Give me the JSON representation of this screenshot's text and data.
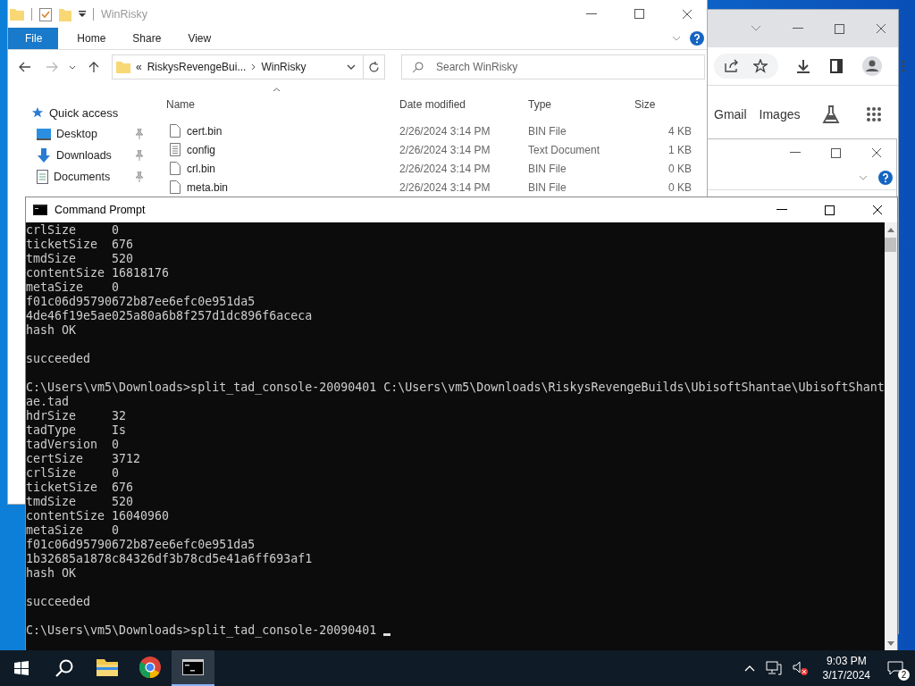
{
  "browser": {
    "links": [
      "Gmail",
      "Images"
    ]
  },
  "explorer": {
    "title": "WinRisky",
    "ribbon_tabs": [
      {
        "label": "File",
        "kind": "file"
      },
      {
        "label": "Home",
        "kind": "tab"
      },
      {
        "label": "Share",
        "kind": "tab"
      },
      {
        "label": "View",
        "kind": "tab"
      }
    ],
    "address": {
      "overflow": "«",
      "path": [
        "RiskysRevengeBui...",
        "WinRisky"
      ]
    },
    "search": {
      "placeholder": "Search WinRisky"
    },
    "nav_items": [
      {
        "label": "Quick access",
        "kind": "star",
        "pinned": false
      },
      {
        "label": "Desktop",
        "kind": "desktop",
        "pinned": true
      },
      {
        "label": "Downloads",
        "kind": "downloads",
        "pinned": true
      },
      {
        "label": "Documents",
        "kind": "documents",
        "pinned": true
      }
    ],
    "columns": [
      "Name",
      "Date modified",
      "Type",
      "Size"
    ],
    "rows": [
      {
        "name": "cert.bin",
        "kind": "file",
        "date": "2/26/2024 3:14 PM",
        "type": "BIN File",
        "size": "4 KB"
      },
      {
        "name": "config",
        "kind": "text",
        "date": "2/26/2024 3:14 PM",
        "type": "Text Document",
        "size": "1 KB"
      },
      {
        "name": "crl.bin",
        "kind": "file",
        "date": "2/26/2024 3:14 PM",
        "type": "BIN File",
        "size": "0 KB"
      },
      {
        "name": "meta.bin",
        "kind": "file",
        "date": "2/26/2024 3:14 PM",
        "type": "BIN File",
        "size": "0 KB"
      }
    ]
  },
  "console": {
    "title": "Command Prompt",
    "blocks": [
      [
        "crlSize     0",
        "ticketSize  676",
        "tmdSize     520",
        "contentSize 16818176",
        "metaSize    0",
        "f01c06d95790672b87ee6efc0e951da5",
        "4de46f19e5ae025a80a6b8f257d1dc896f6aceca",
        "hash OK"
      ],
      [
        "succeeded"
      ],
      [
        "C:\\Users\\vm5\\Downloads>split_tad_console-20090401 C:\\Users\\vm5\\Downloads\\RiskysRevengeBuilds\\UbisoftShantae\\UbisoftShant",
        "ae.tad",
        "hdrSize     32",
        "tadType     Is",
        "tadVersion  0",
        "certSize    3712",
        "crlSize     0",
        "ticketSize  676",
        "tmdSize     520",
        "contentSize 16040960",
        "metaSize    0",
        "f01c06d95790672b87ee6efc0e951da5",
        "1b32685a1878c84326df3b78cd5e41a6ff693af1",
        "hash OK"
      ],
      [
        "succeeded"
      ],
      [
        "C:\\Users\\vm5\\Downloads>split_tad_console-20090401"
      ]
    ]
  },
  "taskbar": {
    "apps": [
      {
        "kind": "explorer",
        "active": false
      },
      {
        "kind": "chrome",
        "active": false
      },
      {
        "kind": "cmd",
        "active": true
      }
    ],
    "time": "9:03 PM",
    "date": "3/17/2024",
    "notifications": "2"
  }
}
